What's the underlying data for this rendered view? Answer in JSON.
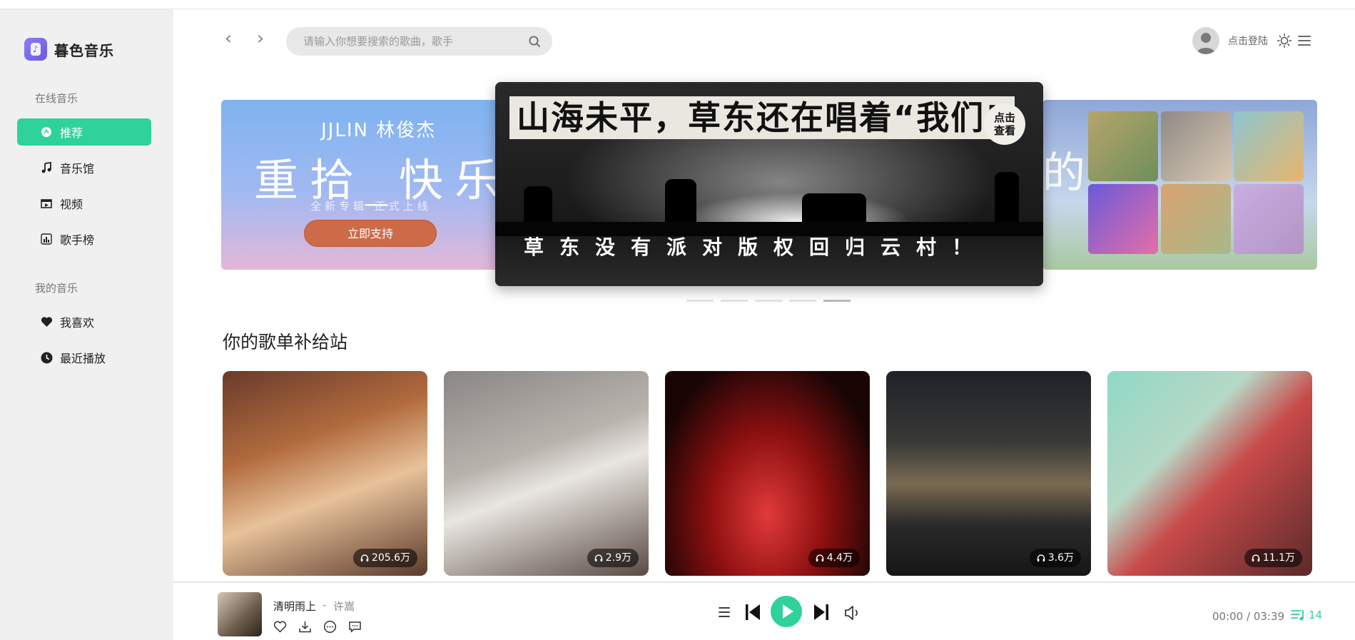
{
  "app": {
    "name": "暮色音乐"
  },
  "sidebar": {
    "online_title": "在线音乐",
    "online_items": [
      {
        "label": "推荐",
        "icon": "recommend-icon",
        "active": true
      },
      {
        "label": "音乐馆",
        "icon": "music-note-icon"
      },
      {
        "label": "视频",
        "icon": "video-icon"
      },
      {
        "label": "歌手榜",
        "icon": "chart-icon"
      }
    ],
    "my_title": "我的音乐",
    "my_items": [
      {
        "label": "我喜欢",
        "icon": "heart-icon"
      },
      {
        "label": "最近播放",
        "icon": "clock-icon"
      }
    ]
  },
  "header": {
    "search_placeholder": "请输入你想要搜索的歌曲，歌手",
    "login_label": "点击登陆"
  },
  "banners": {
    "left": {
      "artist": "JJLIN 林俊杰",
      "title": "重拾_快乐",
      "subtitle": "全新专辑 正式上线",
      "button": "立即支持"
    },
    "center": {
      "title": "山海未平，草东还在唱着“我们”",
      "badge_line1": "点击",
      "badge_line2": "查看",
      "subtitle": "草东没有派对版权回归云村！"
    },
    "right": {
      "glyph": "的"
    },
    "dots": 5,
    "active_dot": 4
  },
  "section": {
    "title": "你的歌单补给站"
  },
  "playlists": [
    {
      "plays": "205.6万"
    },
    {
      "plays": "2.9万"
    },
    {
      "plays": "4.4万"
    },
    {
      "plays": "3.6万"
    },
    {
      "plays": "11.1万"
    }
  ],
  "player": {
    "song": "清明雨上",
    "separator": "-",
    "artist": "许嵩",
    "current_time": "00:00",
    "time_sep": " / ",
    "duration": "03:39",
    "queue_count": "14"
  },
  "colors": {
    "accent": "#2fd29a",
    "banner_button": "#cd6a47"
  }
}
